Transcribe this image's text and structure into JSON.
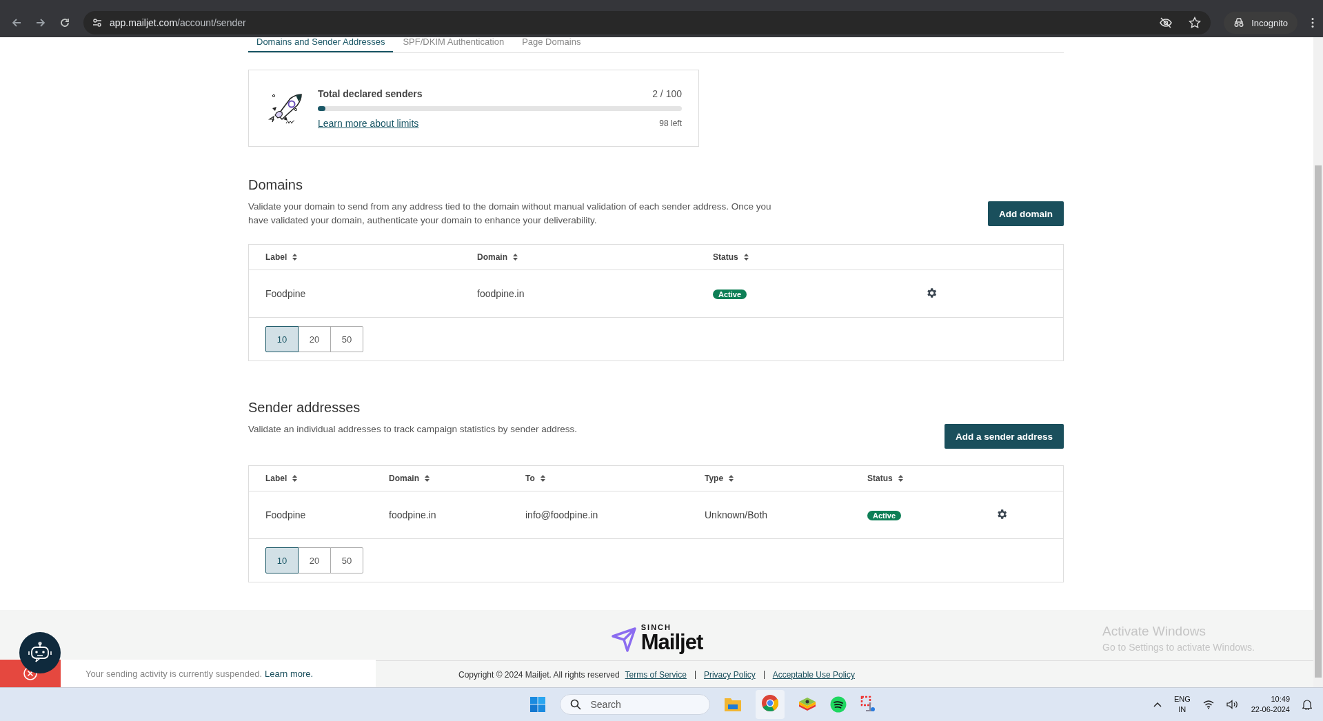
{
  "browser": {
    "url_host": "app.mailjet.com",
    "url_path": "/account/sender",
    "profile": "Incognito"
  },
  "tabs": [
    {
      "label": "Domains and Sender Addresses",
      "selected": true
    },
    {
      "label": "SPF/DKIM Authentication",
      "selected": false
    },
    {
      "label": "Page Domains",
      "selected": false
    }
  ],
  "limits": {
    "title": "Total declared senders",
    "count": "2 / 100",
    "level": 0.02,
    "link": "Learn more about limits",
    "remaining": "98 left"
  },
  "sections": [
    {
      "kind": "domains",
      "title": "Domains",
      "description": "Validate your domain to send from any address tied to the domain without manual validation of each sender address. Once you have validated your domain, authenticate your domain to enhance your deliverability.",
      "button": "Add domain",
      "columns": [
        "Label",
        "Domain",
        "Status"
      ],
      "rows": [
        {
          "cells": [
            "Foodpine",
            "foodpine.in"
          ],
          "status": "Active"
        }
      ],
      "page_sizes": [
        {
          "label": "10",
          "selected": true
        },
        {
          "label": "20",
          "selected": false
        },
        {
          "label": "50",
          "selected": false
        }
      ]
    },
    {
      "kind": "senders",
      "title": "Sender addresses",
      "description": "Validate an individual addresses to track campaign statistics by sender address.",
      "button": "Add a sender address",
      "columns": [
        "Label",
        "Domain",
        "To",
        "Type",
        "Status"
      ],
      "rows": [
        {
          "cells": [
            "Foodpine",
            "foodpine.in",
            "info@foodpine.in",
            "Unknown/Both"
          ],
          "status": "Active"
        }
      ],
      "page_sizes": [
        {
          "label": "10",
          "selected": true
        },
        {
          "label": "20",
          "selected": false
        },
        {
          "label": "50",
          "selected": false
        }
      ]
    }
  ],
  "footer": {
    "brand_top": "SINCH",
    "brand": "Mailjet",
    "copyright": "Copyright © 2024 Mailjet. All rights reserved",
    "links": [
      "Terms of Service",
      "Privacy Policy",
      "Acceptable Use Policy"
    ]
  },
  "notice": {
    "text": "Your sending activity is currently suspended.",
    "link": "Learn more."
  },
  "activation": {
    "title": "Activate Windows",
    "subtitle": "Go to Settings to activate Windows."
  },
  "taskbar": {
    "search_placeholder": "Search",
    "language": "ENG",
    "region": "IN",
    "time": "10:49",
    "date": "22-06-2024"
  }
}
